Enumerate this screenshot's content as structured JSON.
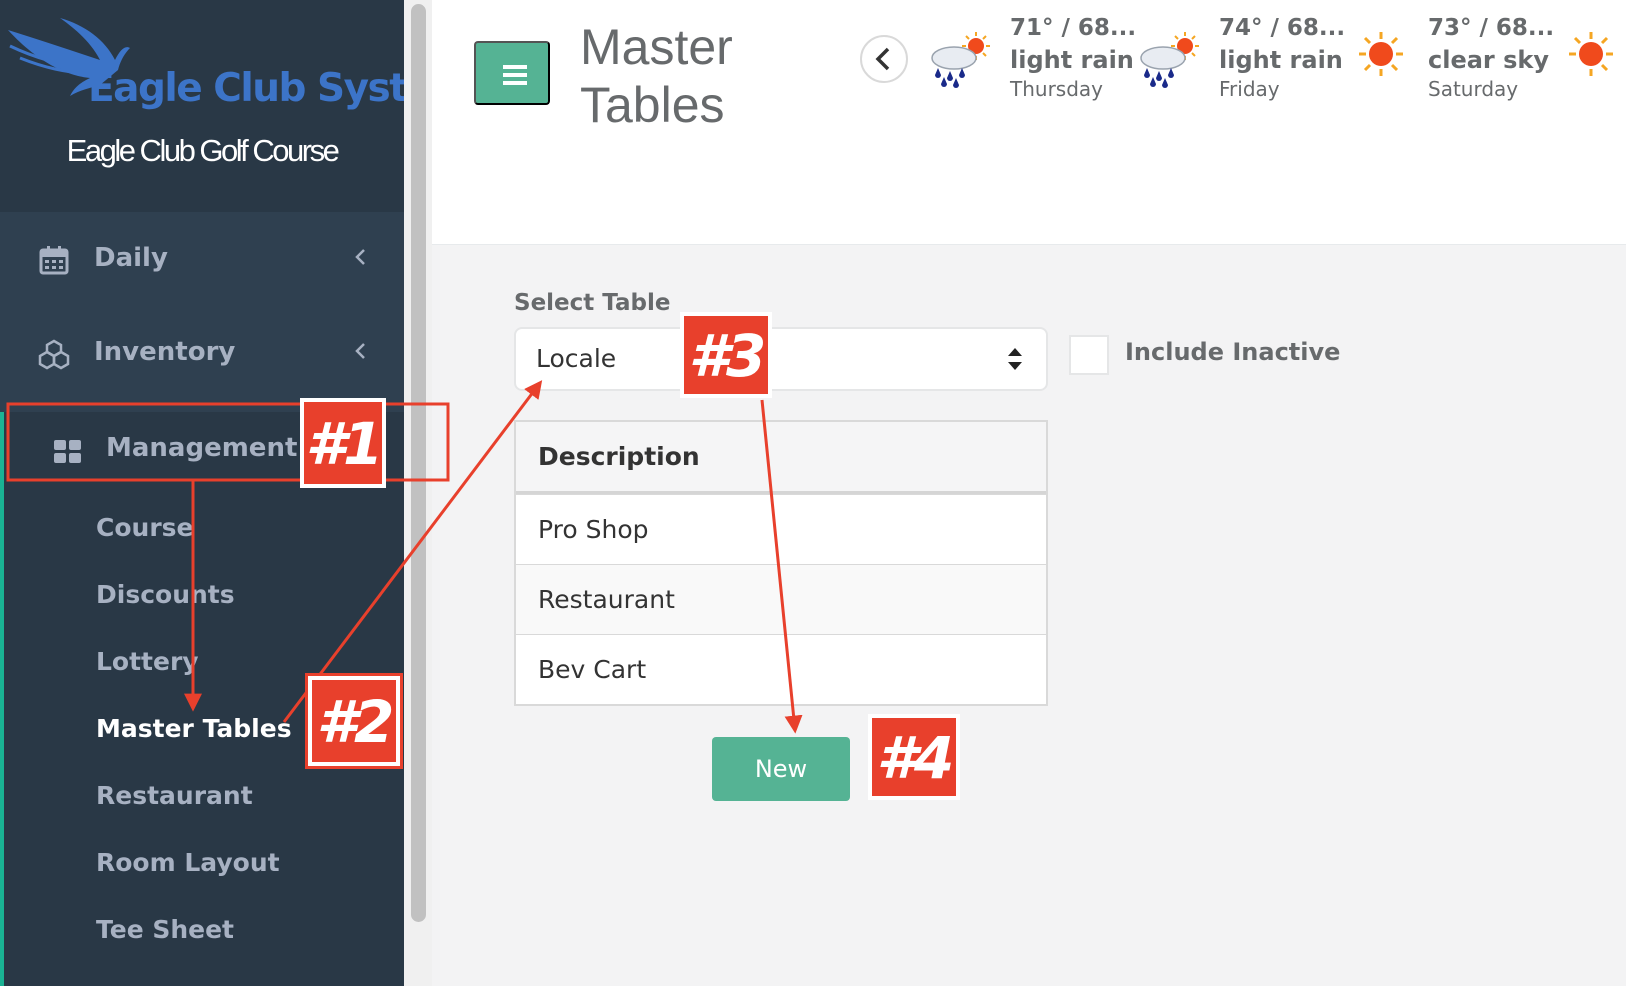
{
  "sidebar": {
    "brand": "Eagle Club Systems",
    "course_name": "Eagle Club Golf Course",
    "nav": [
      {
        "label": "Daily",
        "icon": "calendar-icon"
      },
      {
        "label": "Inventory",
        "icon": "cubes-icon"
      },
      {
        "label": "Management",
        "icon": "grid-icon"
      }
    ],
    "submenu": [
      "Course",
      "Discounts",
      "Lottery",
      "Master Tables",
      "Restaurant",
      "Room Layout",
      "Tee Sheet"
    ],
    "active_submenu": "Master Tables"
  },
  "header": {
    "title_line1": "Master",
    "title_line2": "Tables",
    "weather": [
      {
        "temp": "71° / 68...",
        "condition": "light rain",
        "day": "Thursday",
        "icon": "rain-sun-icon"
      },
      {
        "temp": "74° / 68...",
        "condition": "light rain",
        "day": "Friday",
        "icon": "rain-sun-icon"
      },
      {
        "temp": "73° / 68...",
        "condition": "clear sky",
        "day": "Saturday",
        "icon": "sun-icon"
      }
    ]
  },
  "main": {
    "select_label": "Select Table",
    "select_value": "Locale",
    "include_inactive_label": "Include Inactive",
    "include_inactive_checked": false,
    "table_header": "Description",
    "rows": [
      "Pro Shop",
      "Restaurant",
      "Bev Cart"
    ],
    "new_button": "New"
  },
  "annotations": {
    "step1": "#1",
    "step2": "#2",
    "step3": "#3",
    "step4": "#4",
    "color": "#e8402c"
  },
  "colors": {
    "sidebar_bg": "#2f4050",
    "accent": "#55b394",
    "active_border": "#1ab394",
    "annotation": "#e8402c"
  }
}
